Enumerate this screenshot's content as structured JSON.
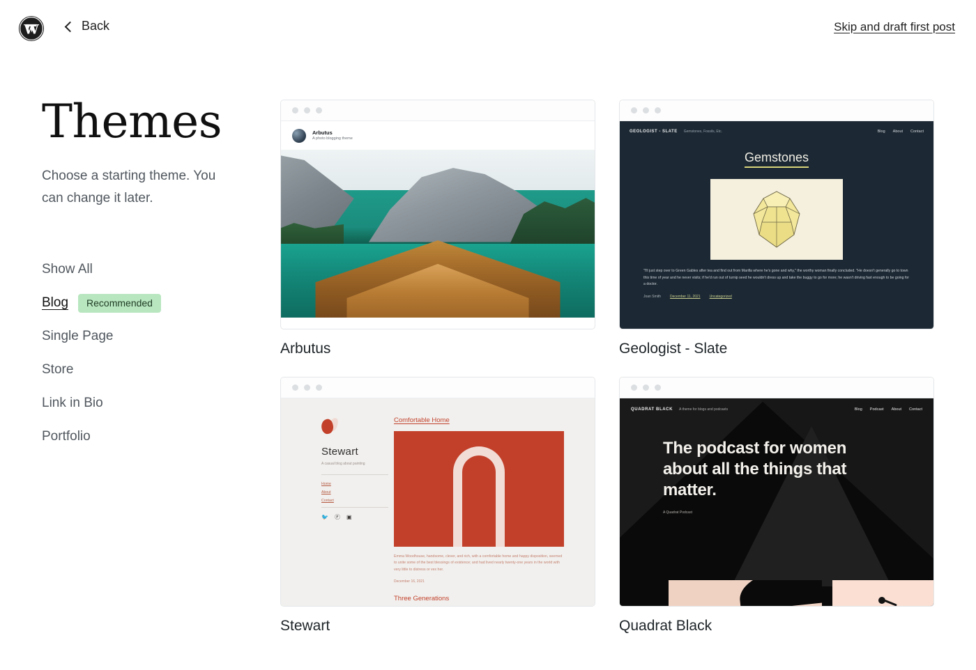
{
  "topbar": {
    "logo_name": "wordpress-logo",
    "back_label": "Back",
    "skip_label": "Skip and draft first post"
  },
  "sidebar": {
    "title": "Themes",
    "subtitle": "Choose a starting theme. You can change it later.",
    "filters": [
      {
        "label": "Show All",
        "active": false,
        "badge": null
      },
      {
        "label": "Blog",
        "active": true,
        "badge": "Recommended"
      },
      {
        "label": "Single Page",
        "active": false,
        "badge": null
      },
      {
        "label": "Store",
        "active": false,
        "badge": null
      },
      {
        "label": "Link in Bio",
        "active": false,
        "badge": null
      },
      {
        "label": "Portfolio",
        "active": false,
        "badge": null
      }
    ],
    "badge_color": "#b8e6bf"
  },
  "themes": [
    {
      "name": "Arbutus",
      "preview": {
        "site_title": "Arbutus",
        "tagline": "A photo blogging theme",
        "image_alt": "Wooden boat bow on a turquoise alpine lake with mountains"
      }
    },
    {
      "name": "Geologist - Slate",
      "preview": {
        "brand": "GEOLOGIST - SLATE",
        "tagline": "Gemstones, Fossils, Etc.",
        "nav": [
          "Blog",
          "About",
          "Contact"
        ],
        "heading": "Gemstones",
        "body": "\"I'll just step over to Green Gables after tea and find out from Marilla where he's gone and why,\" the worthy woman finally concluded. \"He doesn't generally go to town this time of year and he never visits; if he'd run out of turnip seed he wouldn't dress up and take the buggy to go for more; he wasn't driving fast enough to be going for a doctor.",
        "meta_author": "Joan Smith",
        "meta_date": "December 11, 2021",
        "meta_category": "Uncategorized",
        "bg_color": "#1c2833",
        "accent_color": "#d9d47a",
        "gem_bg": "#f5f0dd"
      }
    },
    {
      "name": "Stewart",
      "preview": {
        "site_title": "Stewart",
        "tagline": "A casual blog about painting",
        "nav": [
          "Home",
          "About",
          "Contact"
        ],
        "social": [
          "twitter-icon",
          "facebook-icon",
          "instagram-icon"
        ],
        "post_title": "Comfortable Home",
        "excerpt": "Emma Woodhouse, handsome, clever, and rich, with a comfortable home and happy disposition, seemed to unite some of the best blessings of existence; and had lived nearly twenty-one years in the world with very little to distress or vex her.",
        "date": "December 16, 2021",
        "next_post": "Three Generations",
        "accent_color": "#c2402a",
        "bg_color": "#f1f0ee"
      }
    },
    {
      "name": "Quadrat Black",
      "preview": {
        "brand": "QUADRAT BLACK",
        "tagline": "A theme for blogs and podcasts",
        "nav": [
          "Blog",
          "Podcast",
          "About",
          "Contact"
        ],
        "heading": "The podcast for women about all the things that matter.",
        "subheading": "A Quadrat Podcast",
        "bg_color": "#0a0a0a",
        "image_color": "#f0d2c2"
      }
    }
  ]
}
